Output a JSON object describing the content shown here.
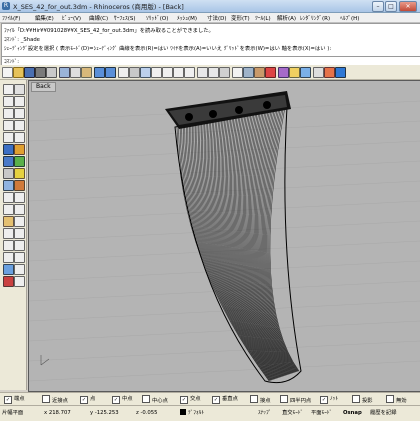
{
  "window": {
    "title": "X_SES_42_for_out.3dm - Rhinoceros (商用版) - [Back]",
    "app_icon": "R",
    "minimize": "–",
    "maximize": "□",
    "close": "✕"
  },
  "menu": [
    "ﾌｧｲﾙ(F)",
    "編集(E)",
    "ﾋﾞｭｰ(V)",
    "曲線(C)",
    "ｻｰﾌｪｽ(S)",
    "ｿﾘｯﾄﾞ(O)",
    "ﾒｯｼｭ(M)",
    "寸法(D)",
    "変形(T)",
    "ﾂｰﾙ(L)",
    "解析(A)",
    "ﾚﾝﾀﾞﾘﾝｸﾞ(R)",
    "ﾍﾙﾌﾟ(H)"
  ],
  "history": [
    "ﾌｧｲﾙ「D:¥¥Hir¥¥091028¥¥X_SES_42_for_out.3dm」を読み取ることができました。",
    "ｺﾏﾝﾄﾞ: _Shade",
    "ｼｪｰﾃﾞｨﾝｸﾞ設定を選択 ( 表示ﾓｰﾄﾞ(D)=ｼｪｰﾃﾞｨﾝｸﾞ  曲線を表示(R)=はい  ﾜｲﾔを表示(A)=いいえ  ｸﾞﾘｯﾄﾞを表示(W)=はい  軸を表示(X)=はい ):"
  ],
  "command_prompt": "ｺﾏﾝﾄﾞ:",
  "viewport": {
    "tab_label": "Back"
  },
  "osnap": [
    {
      "label": "端点",
      "checked": true
    },
    {
      "label": "近接点",
      "checked": false
    },
    {
      "label": "点",
      "checked": true
    },
    {
      "label": "中点",
      "checked": true
    },
    {
      "label": "中心点",
      "checked": false
    },
    {
      "label": "交点",
      "checked": true
    },
    {
      "label": "垂直点",
      "checked": true
    },
    {
      "label": "接点",
      "checked": false
    },
    {
      "label": "四半円点",
      "checked": false
    },
    {
      "label": "ﾉｯﾄ",
      "checked": true
    },
    {
      "label": "投影",
      "checked": false
    },
    {
      "label": "無効",
      "checked": false
    }
  ],
  "status": {
    "cplane": "ｸﾞﾗﾌﾃﾞｨﾌﾋﾟﾝｸﾞ",
    "plane": "片幅平面",
    "x": "x 218.707",
    "y": "y -125.253",
    "z": "z -0.055",
    "layer": "ﾃﾞﾌｫﾙﾄ",
    "snap": "ｽﾅｯﾌﾟ",
    "ortho": "直交ﾓｰﾄﾞ",
    "planar": "平面ﾓｰﾄﾞ",
    "osnap": "Osnap",
    "record": "履歴を記録"
  },
  "colors": {
    "viewport_bg": "#b4b4b4",
    "wire": "#000000",
    "titlebar": "#a9c5e6"
  }
}
